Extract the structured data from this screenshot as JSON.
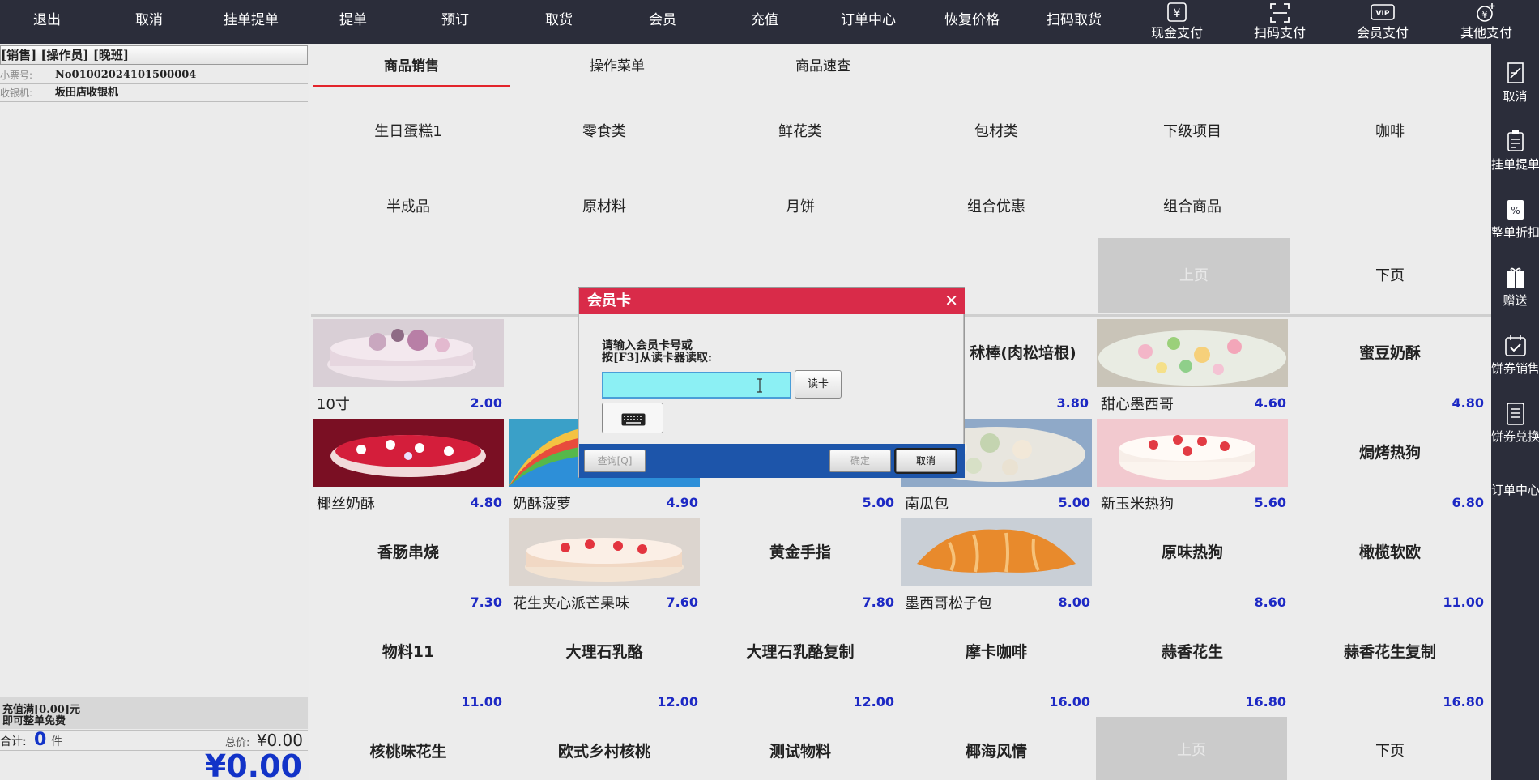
{
  "topbar": {
    "items": [
      "退出",
      "取消",
      "挂单提单",
      "提单",
      "预订",
      "取货",
      "会员",
      "充值",
      "订单中心",
      "恢复价格",
      "扫码取货"
    ],
    "pay": [
      {
        "label": "现金支付",
        "icon": "yen-icon"
      },
      {
        "label": "扫码支付",
        "icon": "scan-icon"
      },
      {
        "label": "会员支付",
        "icon": "vip-icon"
      },
      {
        "label": "其他支付",
        "icon": "yen-plus-icon"
      }
    ]
  },
  "left": {
    "mode": "[销售] [操作员] [晚班]",
    "receipt_label": "小票号:",
    "receipt_value": "No01002024101500004",
    "register_label": "收银机:",
    "register_value": "坂田店收银机",
    "promo_line1": "充值满[0.00]元",
    "promo_line2": "即可整单免费",
    "count_label": "合计:",
    "count_value": "0",
    "count_unit": "件",
    "sum_label": "总价:",
    "sum_value": "¥0.00",
    "big_total": "¥0.00"
  },
  "tabs": [
    "商品销售",
    "操作菜单",
    "商品速查"
  ],
  "categories": [
    [
      "生日蛋糕1",
      "零食类",
      "鲜花类",
      "包材类",
      "下级项目",
      "咖啡"
    ],
    [
      "半成品",
      "原材料",
      "月饼",
      "组合优惠",
      "组合商品",
      ""
    ],
    [
      "",
      "",
      "",
      "",
      "上页",
      "下页"
    ]
  ],
  "products": [
    [
      {
        "name": "10寸",
        "price": "2.00",
        "image": "cake-flowers-pink"
      },
      {
        "name": "",
        "price": "",
        "image": ""
      },
      {
        "name": "秫棒(肉松培根)",
        "price": "3.80",
        "image": ""
      },
      {
        "name": "",
        "price": "",
        "image": ""
      },
      {
        "name": "甜心墨西哥",
        "price": "4.60",
        "image": "cake-flowers-green"
      },
      {
        "name": "蜜豆奶酥",
        "price": "4.80",
        "image": ""
      }
    ],
    [
      {
        "name": "椰丝奶酥",
        "price": "4.80",
        "image": "cake-strawberry-red"
      },
      {
        "name": "奶酥菠萝",
        "price": "4.90",
        "image": "cake-rainbow"
      },
      {
        "name": "",
        "price": "5.00",
        "image": ""
      },
      {
        "name": "南瓜包",
        "price": "5.00",
        "image": "cake-flowers-cream"
      },
      {
        "name": "新玉米热狗",
        "price": "5.60",
        "image": "cake-strawberry-white"
      },
      {
        "name": "焗烤热狗",
        "price": "6.80",
        "image": ""
      }
    ],
    [
      {
        "name": "香肠串烧",
        "price": "7.30",
        "image": ""
      },
      {
        "name": "花生夹心派芒果味",
        "price": "7.60",
        "image": "cake-layer-strawberry"
      },
      {
        "name": "黄金手指",
        "price": "7.80",
        "image": ""
      },
      {
        "name": "墨西哥松子包",
        "price": "8.00",
        "image": "croissant"
      },
      {
        "name": "原味热狗",
        "price": "8.60",
        "image": ""
      },
      {
        "name": "橄榄软欧",
        "price": "11.00",
        "image": ""
      }
    ],
    [
      {
        "name": "物料11",
        "price": "11.00",
        "image": ""
      },
      {
        "name": "大理石乳酪",
        "price": "12.00",
        "image": ""
      },
      {
        "name": "大理石乳酪复制",
        "price": "12.00",
        "image": ""
      },
      {
        "name": "摩卡咖啡",
        "price": "16.00",
        "image": ""
      },
      {
        "name": "蒜香花生",
        "price": "16.80",
        "image": ""
      },
      {
        "name": "蒜香花生复制",
        "price": "16.80",
        "image": ""
      }
    ],
    [
      {
        "name": "核桃味花生",
        "price": "",
        "image": ""
      },
      {
        "name": "欧式乡村核桃",
        "price": "",
        "image": ""
      },
      {
        "name": "测试物料",
        "price": "",
        "image": ""
      },
      {
        "name": "椰海风情",
        "price": "",
        "image": ""
      },
      {
        "name": "上页",
        "price": "",
        "image": ""
      },
      {
        "name": "下页",
        "price": "",
        "image": ""
      }
    ]
  ],
  "rightbar": [
    {
      "label": "取消",
      "icon": "cancel-doc-icon"
    },
    {
      "label": "挂单提单",
      "icon": "clipboard-icon"
    },
    {
      "label": "整单折扣",
      "icon": "discount-icon"
    },
    {
      "label": "赠送",
      "icon": "gift-icon"
    },
    {
      "label": "饼券销售",
      "icon": "calendar-check-icon"
    },
    {
      "label": "饼券兑换",
      "icon": "list-doc-icon"
    },
    {
      "label": "订单中心",
      "icon": ""
    }
  ],
  "dialog": {
    "title": "会员卡",
    "close": "✕",
    "prompt": "请输入会员卡号或\n按[F3]从读卡器读取:",
    "input_value": "",
    "read_card": "读卡",
    "query": "查询[Q]",
    "confirm": "确定",
    "cancel": "取消"
  },
  "colors": {
    "topbar_bg": "#2b2d3a",
    "tab_active_underline": "#e3242b",
    "price_blue": "#1d29c4",
    "total_blue": "#1233c8",
    "dialog_title_bg": "#d92b49",
    "dialog_footer_bg": "#1d55aa",
    "input_bg": "#8cf0f4"
  }
}
